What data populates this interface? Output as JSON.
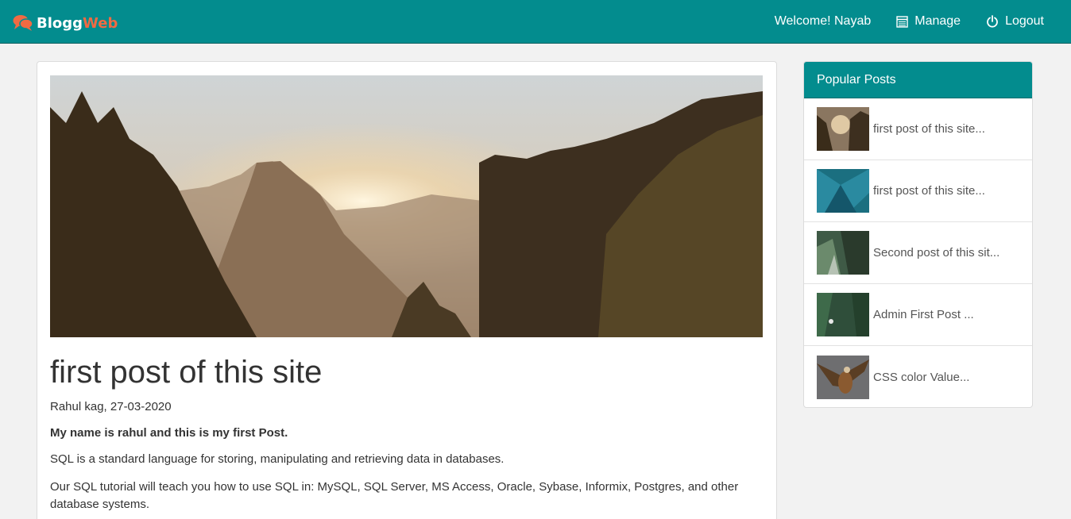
{
  "brand": {
    "name_part1": "Blogg",
    "name_part2": "Web"
  },
  "nav": {
    "welcome": "Welcome! Nayab",
    "manage": "Manage",
    "logout": "Logout"
  },
  "post": {
    "title": "first post of this site",
    "meta": "Rahul kag, 27-03-2020",
    "intro_bold": "My name is rahul and this is my first Post.",
    "para1": "SQL is a standard language for storing, manipulating and retrieving data in databases.",
    "para2": "Our SQL tutorial will teach you how to use SQL in: MySQL, SQL Server, MS Access, Oracle, Sybase, Informix, Postgres, and other database systems."
  },
  "sidebar": {
    "heading": "Popular Posts",
    "items": [
      {
        "label": "first post of this site..."
      },
      {
        "label": "first post of this site..."
      },
      {
        "label": "Second post of this sit..."
      },
      {
        "label": "Admin First Post ..."
      },
      {
        "label": "CSS color Value..."
      }
    ]
  },
  "colors": {
    "primary": "#038c8e",
    "brand_accent": "#f06a43",
    "background": "#f2f2f2"
  }
}
